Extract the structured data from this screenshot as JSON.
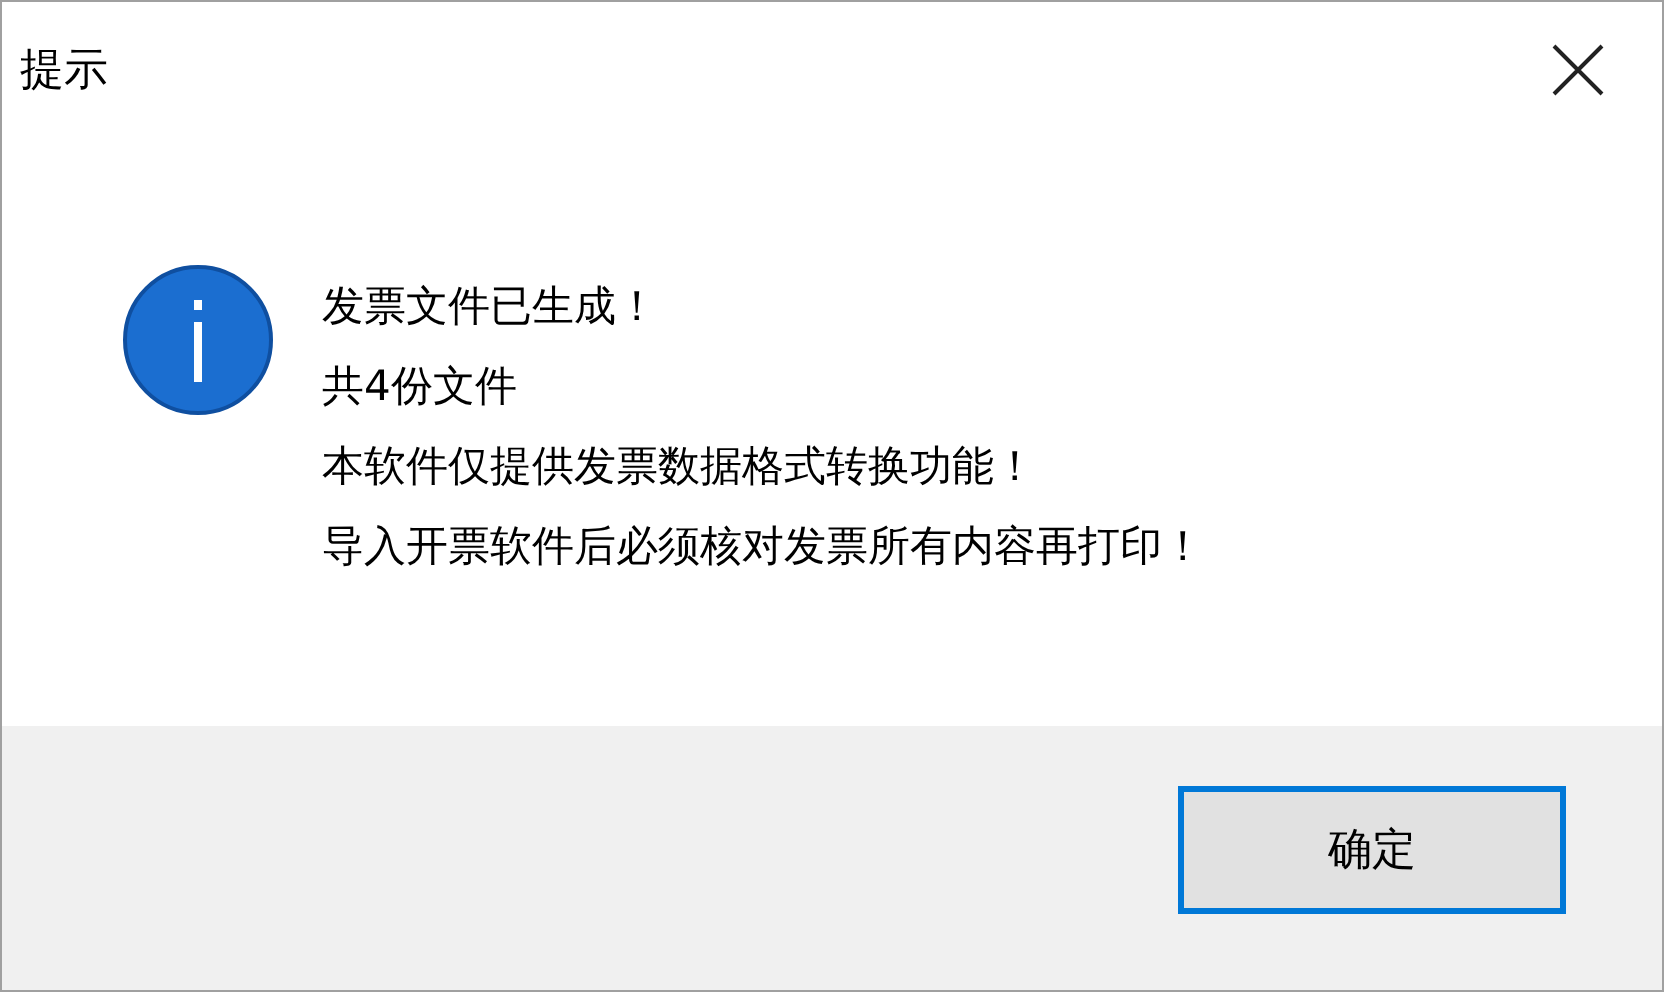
{
  "window": {
    "title": "提示"
  },
  "message": {
    "lines": [
      "发票文件已生成！",
      "共4份文件",
      "本软件仅提供发票数据格式转换功能！",
      "导入开票软件后必须核对发票所有内容再打印！"
    ]
  },
  "buttons": [
    {
      "label": "确定",
      "selected": true
    }
  ]
}
